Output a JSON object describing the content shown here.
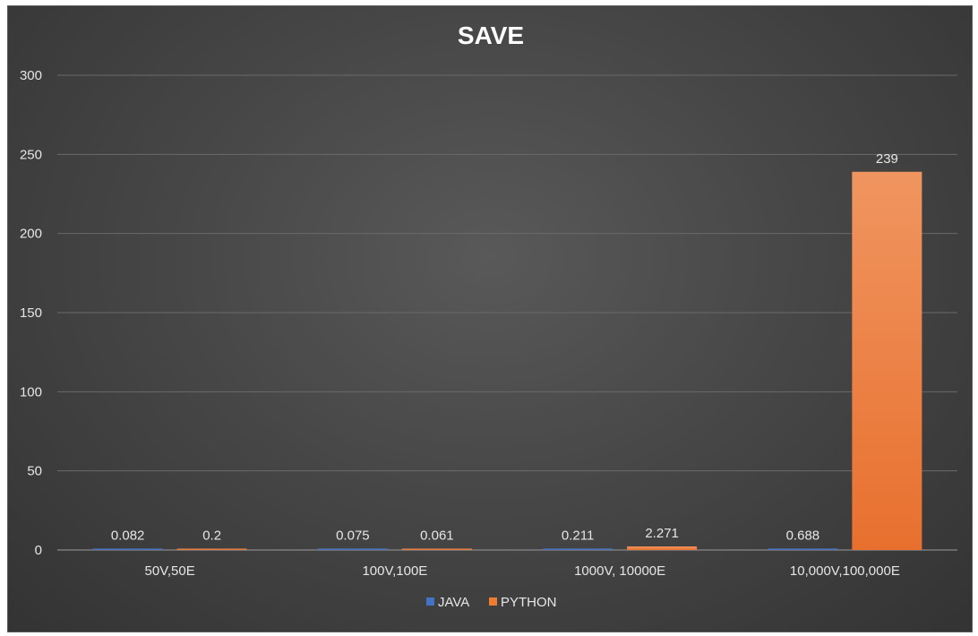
{
  "chart_data": {
    "type": "bar",
    "title": "SAVE",
    "categories": [
      "50V,50E",
      "100V,100E",
      "1000V, 10000E",
      "10,000V,100,000E"
    ],
    "series": [
      {
        "name": "JAVA",
        "color": "#4472c4",
        "values": [
          0.082,
          0.075,
          0.211,
          0.688
        ],
        "labels": [
          "0.082",
          "0.075",
          "0.211",
          "0.688"
        ]
      },
      {
        "name": "PYTHON",
        "color": "#ed7d31",
        "values": [
          0.2,
          0.061,
          2.271,
          239
        ],
        "labels": [
          "0.2",
          "0.061",
          "2.271",
          "239"
        ]
      }
    ],
    "ylim": [
      0,
      300
    ],
    "yticks": [
      0,
      50,
      100,
      150,
      200,
      250,
      300
    ],
    "xlabel": "",
    "ylabel": "",
    "grid": true,
    "legend_position": "bottom",
    "background": "#474747"
  }
}
